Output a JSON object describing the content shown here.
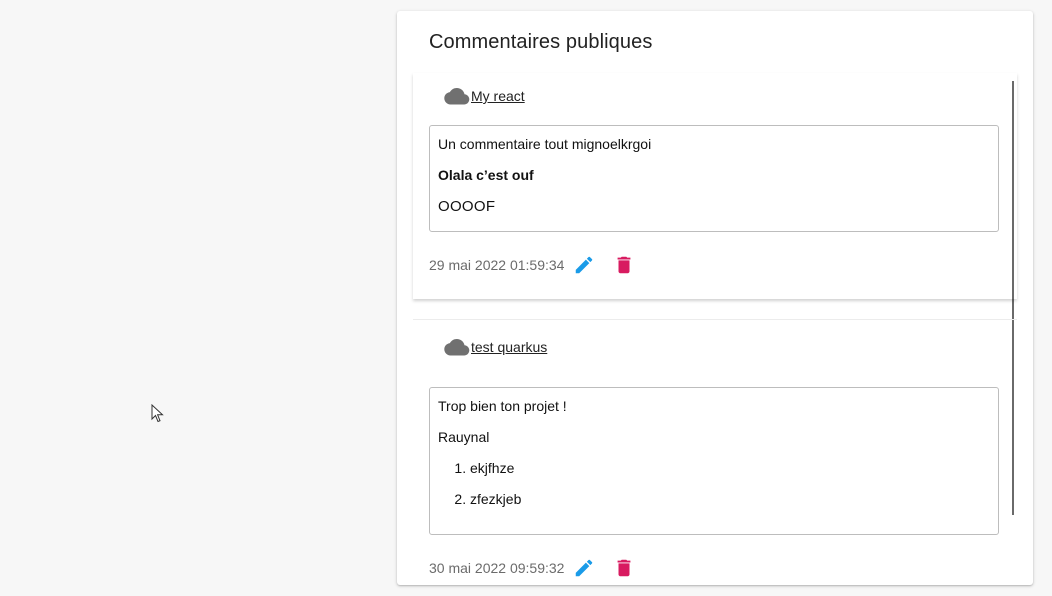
{
  "panel": {
    "title": "Commentaires publiques"
  },
  "comments": [
    {
      "project": "My react",
      "project_icon": "cloud-icon",
      "content": {
        "line1": "Un commentaire tout mignoelkrgoi",
        "line2": "Olala c’est ouf",
        "line3": "OOOOF"
      },
      "date": "29 mai 2022 01:59:34"
    },
    {
      "project": "test quarkus",
      "project_icon": "cloud-icon",
      "content": {
        "line1": "Trop bien ton projet !",
        "line2": "Rauynal",
        "list": [
          "ekjfhze",
          "zfezkjeb"
        ]
      },
      "date": "30 mai 2022 09:59:32"
    }
  ],
  "colors": {
    "edit": "#1a9be8",
    "delete": "#d81b60",
    "cloud": "#707070"
  }
}
